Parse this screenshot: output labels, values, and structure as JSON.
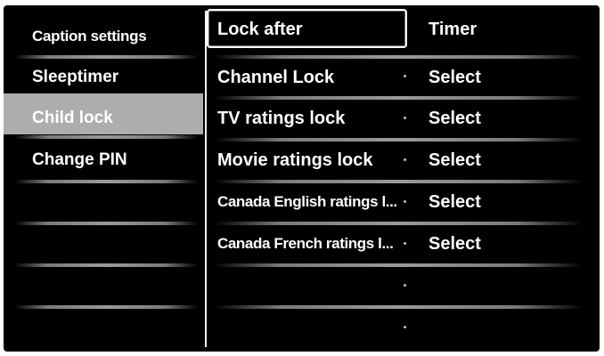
{
  "menu_left": {
    "items": [
      {
        "label": "Caption settings"
      },
      {
        "label": "Sleeptimer"
      },
      {
        "label": "Child lock"
      },
      {
        "label": "Change PIN"
      }
    ],
    "selected_index": 2
  },
  "menu_middle": {
    "items": [
      {
        "label": "Lock after"
      },
      {
        "label": "Channel Lock"
      },
      {
        "label": "TV ratings lock"
      },
      {
        "label": "Movie ratings lock"
      },
      {
        "label": "Canada English ratings l..."
      },
      {
        "label": "Canada French ratings l..."
      }
    ],
    "focused_index": 0
  },
  "menu_right": {
    "values": [
      "Timer",
      "Select",
      "Select",
      "Select",
      "Select",
      "Select"
    ]
  },
  "colors": {
    "background": "#000000",
    "text": "#ffffff",
    "selected_bg": "#adadad"
  }
}
